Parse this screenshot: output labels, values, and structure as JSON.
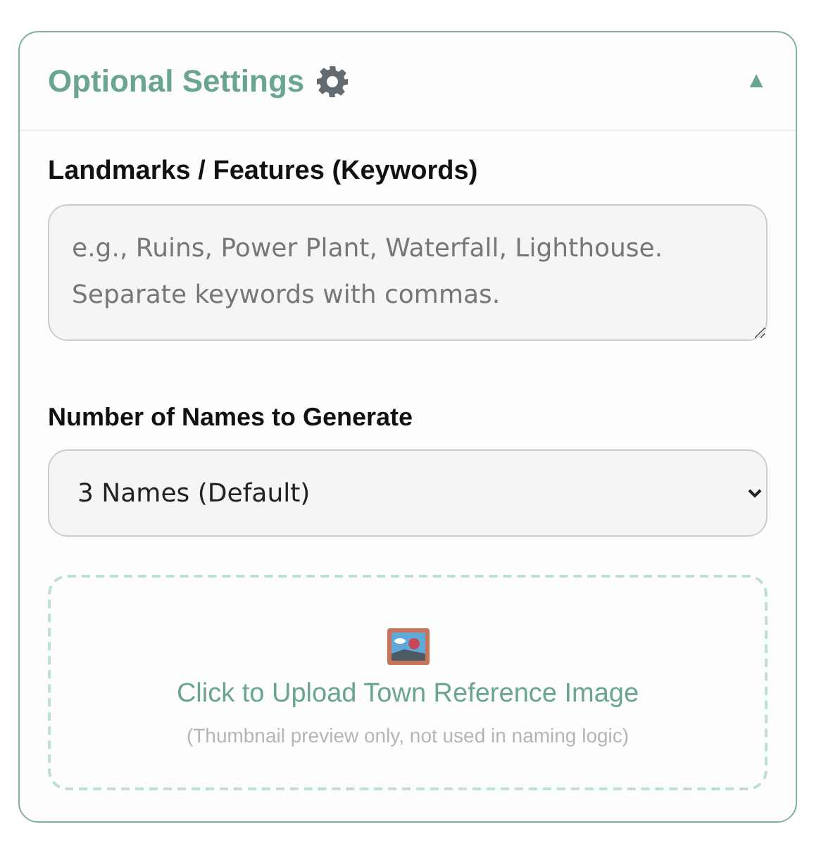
{
  "panel": {
    "title": "Optional Settings",
    "toggle": "▲",
    "expanded": true
  },
  "keywords": {
    "label": "Landmarks / Features (Keywords)",
    "placeholder": "e.g., Ruins, Power Plant, Waterfall, Lighthouse. Separate keywords with commas."
  },
  "count": {
    "label": "Number of Names to Generate",
    "value": "3 Names (Default)"
  },
  "upload": {
    "title": "Click to Upload Town Reference Image",
    "note": "(Thumbnail preview only, not used in naming logic)"
  }
}
